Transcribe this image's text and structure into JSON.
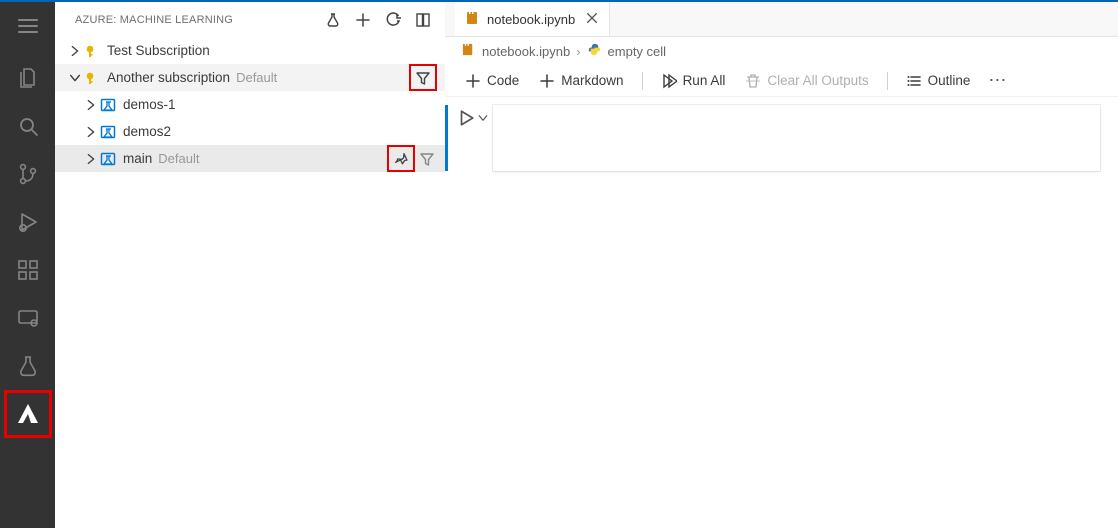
{
  "sidebar": {
    "title": "AZURE: MACHINE LEARNING",
    "actions": {
      "beaker": "beaker",
      "add": "add",
      "refresh": "refresh",
      "collapse": "collapse"
    },
    "subscriptions": [
      {
        "label": "Test Subscription",
        "expanded": false,
        "default": ""
      },
      {
        "label": "Another subscription",
        "expanded": true,
        "default": "Default",
        "children": [
          {
            "label": "demos-1",
            "default": ""
          },
          {
            "label": "demos2",
            "default": ""
          },
          {
            "label": "main",
            "default": "Default",
            "pinned": true
          }
        ]
      }
    ]
  },
  "tab": {
    "filename": "notebook.ipynb"
  },
  "breadcrumb": {
    "file": "notebook.ipynb",
    "cell": "empty cell"
  },
  "toolbar": {
    "code": "Code",
    "markdown": "Markdown",
    "runall": "Run All",
    "clear": "Clear All Outputs",
    "outline": "Outline"
  }
}
